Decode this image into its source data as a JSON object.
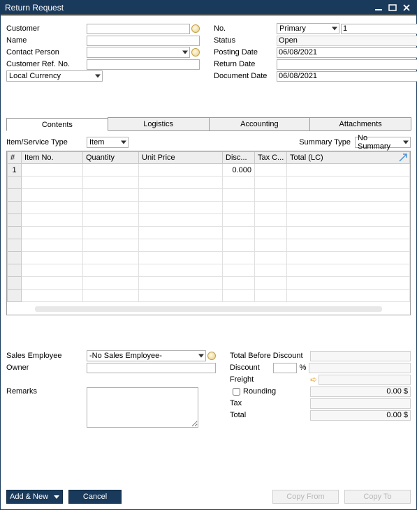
{
  "window": {
    "title": "Return Request"
  },
  "header": {
    "left": {
      "customer_label": "Customer",
      "customer_value": "",
      "name_label": "Name",
      "name_value": "",
      "contact_label": "Contact Person",
      "contact_value": "",
      "refno_label": "Customer Ref. No.",
      "refno_value": "",
      "currency_value": "Local Currency"
    },
    "right": {
      "no_label": "No.",
      "no_series": "Primary",
      "no_value": "1",
      "status_label": "Status",
      "status_value": "Open",
      "posting_label": "Posting Date",
      "posting_value": "06/08/2021",
      "return_label": "Return Date",
      "return_value": "",
      "docdate_label": "Document Date",
      "docdate_value": "06/08/2021"
    }
  },
  "tabs": {
    "contents": "Contents",
    "logistics": "Logistics",
    "accounting": "Accounting",
    "attachments": "Attachments"
  },
  "contents": {
    "item_service_label": "Item/Service Type",
    "item_service_value": "Item",
    "summary_type_label": "Summary Type",
    "summary_type_value": "No Summary",
    "cols": {
      "num": "#",
      "itemno": "Item No.",
      "qty": "Quantity",
      "unitprice": "Unit Price",
      "disc": "Disc...",
      "taxc": "Tax C...",
      "totallc": "Total (LC)"
    },
    "rows": [
      {
        "num": "1",
        "itemno": "",
        "qty": "",
        "unitprice": "",
        "disc": "0.000",
        "taxc": "",
        "totallc": ""
      }
    ]
  },
  "footer": {
    "sales_emp_label": "Sales Employee",
    "sales_emp_value": "-No Sales Employee-",
    "owner_label": "Owner",
    "owner_value": "",
    "remarks_label": "Remarks",
    "remarks_value": ""
  },
  "totals": {
    "tbd_label": "Total Before Discount",
    "tbd_value": "",
    "discount_label": "Discount",
    "discount_pct": "",
    "pct_symbol": "%",
    "discount_value": "",
    "freight_label": "Freight",
    "freight_value": "",
    "rounding_label": "Rounding",
    "rounding_value": "0.00 $",
    "tax_label": "Tax",
    "tax_value": "",
    "total_label": "Total",
    "total_value": "0.00 $"
  },
  "buttons": {
    "add_new": "Add & New",
    "cancel": "Cancel",
    "copy_from": "Copy From",
    "copy_to": "Copy To"
  }
}
